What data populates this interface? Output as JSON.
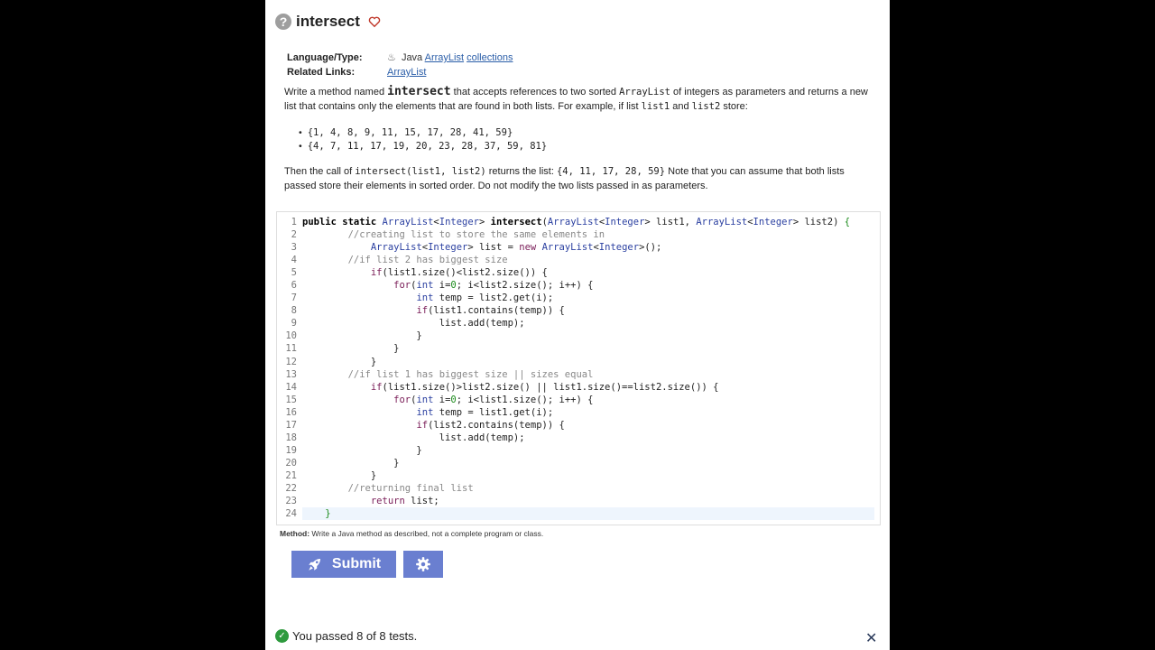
{
  "problem": {
    "title": "intersect",
    "language_label": "Language/Type:",
    "language_value": "Java",
    "type_links": [
      "ArrayList",
      "collections"
    ],
    "related_label": "Related Links:",
    "related_link": "ArrayList"
  },
  "description": {
    "p1_a": "Write a method named ",
    "p1_method": "intersect",
    "p1_b": " that accepts references to two sorted ",
    "p1_type": "ArrayList",
    "p1_c": " of integers as parameters and returns a new list that contains only the elements that are found in both lists. For example, if list ",
    "p1_list1": "list1",
    "p1_d": " and ",
    "p1_list2": "list2",
    "p1_e": " store:",
    "list_items": [
      "{1, 4, 8, 9, 11, 15, 17, 28, 41, 59}",
      "{4, 7, 11, 17, 19, 20, 23, 28, 37, 59, 81}"
    ],
    "p2_a": "Then the call of ",
    "p2_call": "intersect(list1, list2)",
    "p2_b": " returns the list: ",
    "p2_result": "{4, 11, 17, 28, 59}",
    "p2_c": " Note that you can assume that both lists passed store their elements in sorted order. Do not modify the two lists passed in as parameters."
  },
  "editor": {
    "line_numbers": [
      "1",
      "2",
      "3",
      "4",
      "5",
      "6",
      "7",
      "8",
      "9",
      "10",
      "11",
      "12",
      "13",
      "14",
      "15",
      "16",
      "17",
      "18",
      "19",
      "20",
      "21",
      "22",
      "23",
      "24"
    ],
    "active_line": 24
  },
  "method_note": {
    "label": "Method:",
    "text": " Write a Java method as described, not a complete program or class."
  },
  "buttons": {
    "submit_label": "Submit"
  },
  "result": {
    "text": "You passed 8 of 8 tests."
  },
  "colors": {
    "button": "#6a7fd0",
    "success": "#2e9a3e",
    "link": "#2b5ea8"
  }
}
